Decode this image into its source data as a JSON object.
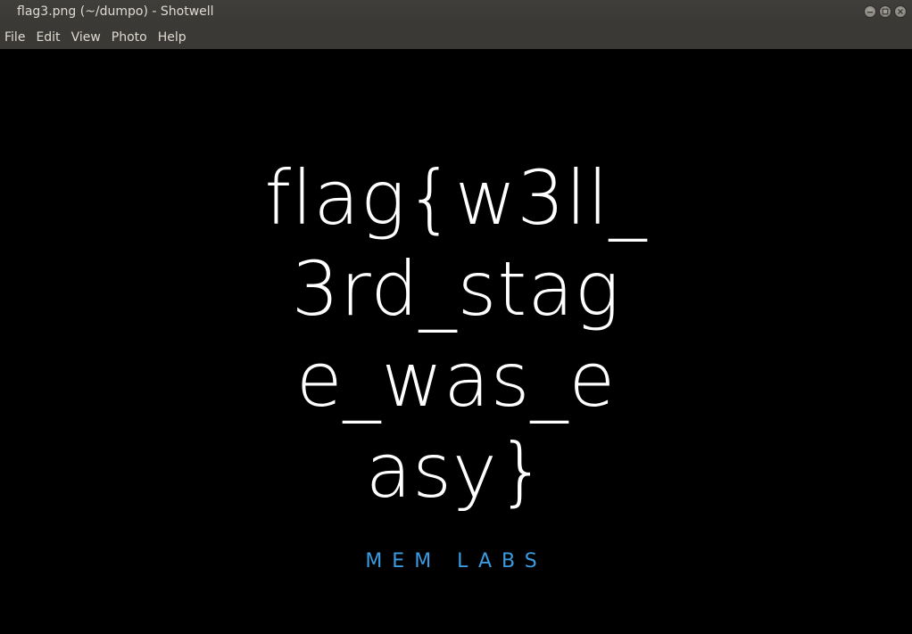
{
  "window": {
    "title": "flag3.png (~/dumpo) - Shotwell"
  },
  "menubar": {
    "items": [
      "File",
      "Edit",
      "View",
      "Photo",
      "Help"
    ]
  },
  "photo": {
    "flag_lines": [
      "flag{w3ll_",
      "3rd_stag",
      "e_was_e",
      "asy}"
    ],
    "brand": "MEM LABS",
    "brand_color": "#3b9be0",
    "background": "#000000"
  }
}
